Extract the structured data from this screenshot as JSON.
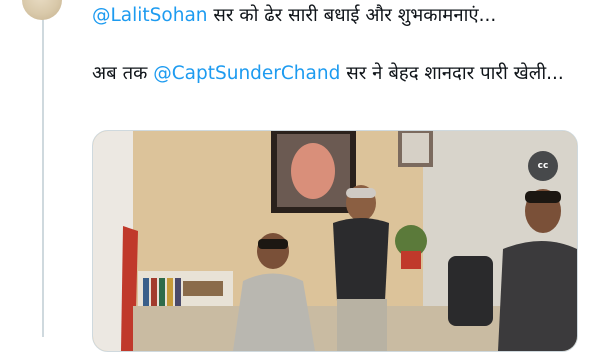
{
  "tweet": {
    "line1_mention": "@LalitSohan",
    "line1_text": " सर को ढेर सारी बधाई और शुभकामनाएं...",
    "line2_prefix": "अब तक ",
    "line2_mention": "@CaptSunderChand",
    "line2_rest": " सर ने बेहद शानदार पारी खेली..."
  },
  "media": {
    "cc_label": "cc",
    "cc_icon": "closed-captions-icon"
  },
  "colors": {
    "mention": "#1d9bf0",
    "text": "#0f1419",
    "border": "#cfd9de"
  }
}
